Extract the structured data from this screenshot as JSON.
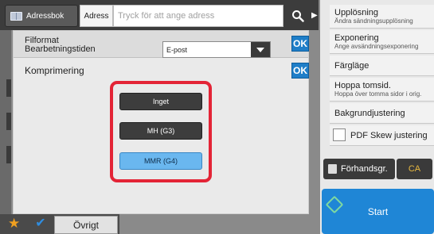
{
  "topbar": {
    "address_book_label": "Adressbok",
    "address_label": "Adress",
    "address_placeholder": "Tryck för att ange adress"
  },
  "panel": {
    "file_format_label_line1": "Filformat",
    "file_format_label_line2": "Bearbetningstiden",
    "file_format_value": "E-post",
    "ok_label": "OK",
    "compression_label": "Komprimering",
    "options": [
      "Inget",
      "MH (G3)",
      "MMR (G4)"
    ],
    "selected_option": "MMR (G4)"
  },
  "right_panel": {
    "items": [
      {
        "title": "Upplösning",
        "subtitle": "Ändra sändningsupplösning"
      },
      {
        "title": "Exponering",
        "subtitle": "Ange avsändningsexponering"
      },
      {
        "title": "Färgläge",
        "subtitle": ""
      },
      {
        "title": "Hoppa tomsid.",
        "subtitle": "Hoppa över tomma sidor i orig."
      },
      {
        "title": "Bakgrundjustering",
        "subtitle": ""
      },
      {
        "title": "PDF Skew justering",
        "subtitle": ""
      }
    ],
    "preview_label": "Förhandsgr.",
    "ca_label": "CA",
    "start_label": "Start"
  },
  "bottom": {
    "other_label": "Övrigt"
  },
  "colors": {
    "accent_blue": "#1f86d6",
    "selected_option": "#6ab7ef",
    "highlight_frame": "#e32436"
  }
}
